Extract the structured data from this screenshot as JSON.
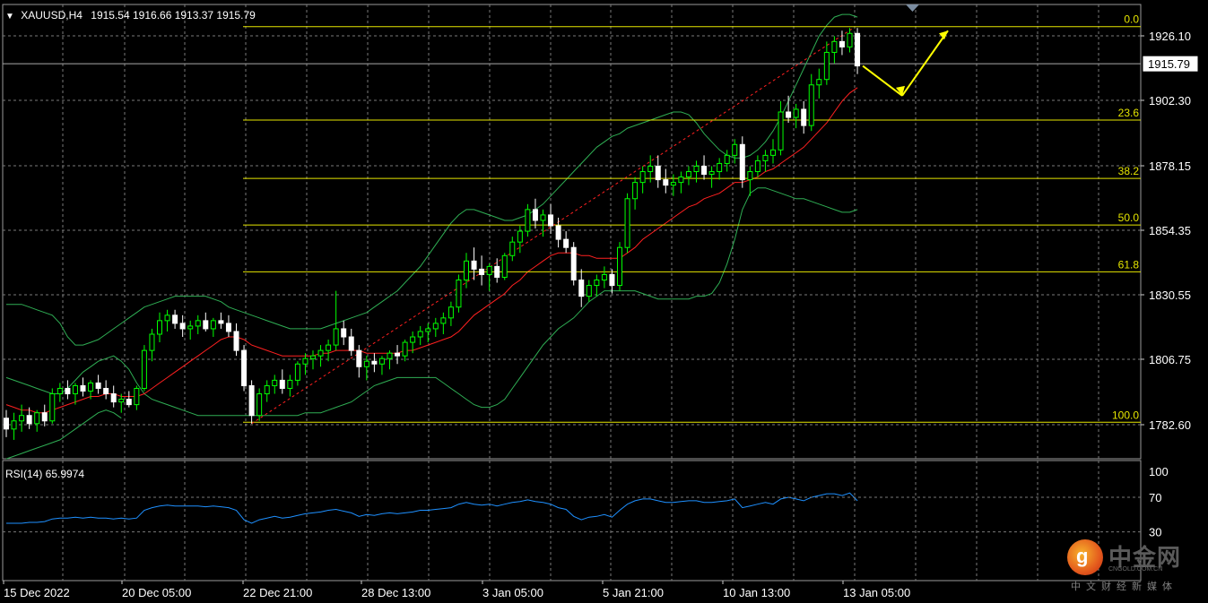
{
  "header": {
    "symbol": "XAUUSD,H4",
    "ohlc": "1915.54 1916.66 1913.37 1915.79"
  },
  "current_price": "1915.79",
  "rsi_label": "RSI(14) 65.9974",
  "watermark": {
    "brand": "中金网",
    "domain": "CNGOLD.COM.CN",
    "tagline": "中文财经新媒体",
    "logo_char": "g"
  },
  "colors": {
    "background": "#000000",
    "grid": "#7a7a7a",
    "bull": "#00ff00",
    "bear": "#ffffff",
    "ma": "#ff2020",
    "bollinger": "#2fae54",
    "fib": "#e6e600",
    "rsi": "#1e90ff",
    "trend": "#ff2020",
    "arrow": "#ffff00"
  },
  "chart_data": [
    {
      "type": "candlestick",
      "title": "XAUUSD,H4",
      "x_tick_labels": [
        "15 Dec 2022",
        "20 Dec 05:00",
        "22 Dec 21:00",
        "28 Dec 13:00",
        "3 Jan 05:00",
        "5 Jan 21:00",
        "10 Jan 13:00",
        "13 Jan 05:00"
      ],
      "y_tick_labels": [
        "1926.10",
        "1902.30",
        "1878.15",
        "1854.35",
        "1830.55",
        "1806.75",
        "1782.60"
      ],
      "ylim": [
        1769,
        1935
      ],
      "grid": true,
      "candles_ohlc": [
        [
          1785,
          1788,
          1778,
          1781
        ],
        [
          1781,
          1787,
          1777,
          1784
        ],
        [
          1784,
          1790,
          1780,
          1786
        ],
        [
          1786,
          1789,
          1781,
          1783
        ],
        [
          1783,
          1788,
          1780,
          1787
        ],
        [
          1787,
          1790,
          1782,
          1784
        ],
        [
          1784,
          1796,
          1783,
          1794
        ],
        [
          1794,
          1798,
          1791,
          1796
        ],
        [
          1796,
          1799,
          1792,
          1794
        ],
        [
          1794,
          1798,
          1790,
          1797
        ],
        [
          1797,
          1800,
          1793,
          1795
        ],
        [
          1795,
          1799,
          1792,
          1798
        ],
        [
          1798,
          1801,
          1794,
          1796
        ],
        [
          1796,
          1799,
          1792,
          1794
        ],
        [
          1794,
          1797,
          1789,
          1791
        ],
        [
          1791,
          1794,
          1787,
          1792
        ],
        [
          1792,
          1795,
          1789,
          1790
        ],
        [
          1790,
          1797,
          1788,
          1796
        ],
        [
          1796,
          1812,
          1795,
          1810
        ],
        [
          1810,
          1818,
          1806,
          1816
        ],
        [
          1816,
          1824,
          1813,
          1821
        ],
        [
          1821,
          1825,
          1817,
          1823
        ],
        [
          1823,
          1825,
          1818,
          1820
        ],
        [
          1820,
          1823,
          1815,
          1818
        ],
        [
          1818,
          1821,
          1814,
          1819
        ],
        [
          1819,
          1823,
          1816,
          1821
        ],
        [
          1821,
          1824,
          1817,
          1818
        ],
        [
          1818,
          1822,
          1815,
          1821
        ],
        [
          1821,
          1824,
          1818,
          1820
        ],
        [
          1820,
          1823,
          1815,
          1817
        ],
        [
          1817,
          1820,
          1808,
          1810
        ],
        [
          1810,
          1812,
          1795,
          1797
        ],
        [
          1797,
          1799,
          1783,
          1786
        ],
        [
          1786,
          1796,
          1784,
          1794
        ],
        [
          1794,
          1799,
          1791,
          1797
        ],
        [
          1797,
          1801,
          1794,
          1799
        ],
        [
          1799,
          1803,
          1794,
          1796
        ],
        [
          1796,
          1801,
          1793,
          1799
        ],
        [
          1799,
          1806,
          1797,
          1805
        ],
        [
          1805,
          1809,
          1801,
          1807
        ],
        [
          1807,
          1810,
          1803,
          1808
        ],
        [
          1808,
          1812,
          1804,
          1810
        ],
        [
          1810,
          1814,
          1806,
          1812
        ],
        [
          1812,
          1832,
          1810,
          1818
        ],
        [
          1818,
          1821,
          1812,
          1815
        ],
        [
          1815,
          1818,
          1808,
          1810
        ],
        [
          1810,
          1812,
          1800,
          1804
        ],
        [
          1804,
          1808,
          1799,
          1806
        ],
        [
          1806,
          1809,
          1802,
          1805
        ],
        [
          1805,
          1808,
          1801,
          1807
        ],
        [
          1807,
          1810,
          1803,
          1809
        ],
        [
          1809,
          1812,
          1805,
          1808
        ],
        [
          1808,
          1814,
          1806,
          1813
        ],
        [
          1813,
          1817,
          1809,
          1815
        ],
        [
          1815,
          1819,
          1812,
          1817
        ],
        [
          1817,
          1820,
          1813,
          1818
        ],
        [
          1818,
          1822,
          1815,
          1820
        ],
        [
          1820,
          1824,
          1816,
          1822
        ],
        [
          1822,
          1828,
          1819,
          1826
        ],
        [
          1826,
          1838,
          1824,
          1836
        ],
        [
          1836,
          1846,
          1833,
          1843
        ],
        [
          1843,
          1848,
          1836,
          1840
        ],
        [
          1840,
          1845,
          1834,
          1838
        ],
        [
          1838,
          1842,
          1832,
          1841
        ],
        [
          1841,
          1844,
          1835,
          1837
        ],
        [
          1837,
          1846,
          1836,
          1845
        ],
        [
          1845,
          1852,
          1843,
          1850
        ],
        [
          1850,
          1856,
          1846,
          1854
        ],
        [
          1854,
          1864,
          1852,
          1862
        ],
        [
          1862,
          1866,
          1855,
          1858
        ],
        [
          1858,
          1862,
          1852,
          1860
        ],
        [
          1860,
          1864,
          1853,
          1856
        ],
        [
          1856,
          1859,
          1848,
          1851
        ],
        [
          1851,
          1854,
          1846,
          1848
        ],
        [
          1848,
          1850,
          1834,
          1836
        ],
        [
          1836,
          1840,
          1826,
          1830
        ],
        [
          1830,
          1836,
          1828,
          1834
        ],
        [
          1834,
          1838,
          1830,
          1836
        ],
        [
          1836,
          1841,
          1833,
          1838
        ],
        [
          1838,
          1840,
          1831,
          1834
        ],
        [
          1834,
          1850,
          1832,
          1848
        ],
        [
          1848,
          1868,
          1846,
          1866
        ],
        [
          1866,
          1874,
          1862,
          1872
        ],
        [
          1872,
          1878,
          1868,
          1876
        ],
        [
          1876,
          1882,
          1872,
          1878
        ],
        [
          1878,
          1882,
          1870,
          1873
        ],
        [
          1873,
          1877,
          1868,
          1871
        ],
        [
          1871,
          1875,
          1867,
          1872
        ],
        [
          1872,
          1876,
          1868,
          1874
        ],
        [
          1874,
          1878,
          1871,
          1876
        ],
        [
          1876,
          1880,
          1872,
          1878
        ],
        [
          1878,
          1882,
          1873,
          1875
        ],
        [
          1875,
          1878,
          1870,
          1876
        ],
        [
          1876,
          1881,
          1873,
          1879
        ],
        [
          1879,
          1884,
          1876,
          1882
        ],
        [
          1882,
          1888,
          1879,
          1886
        ],
        [
          1886,
          1889,
          1870,
          1873
        ],
        [
          1873,
          1878,
          1867,
          1876
        ],
        [
          1876,
          1882,
          1874,
          1880
        ],
        [
          1880,
          1884,
          1876,
          1882
        ],
        [
          1882,
          1888,
          1879,
          1884
        ],
        [
          1884,
          1902,
          1882,
          1898
        ],
        [
          1898,
          1904,
          1894,
          1896
        ],
        [
          1896,
          1901,
          1892,
          1899
        ],
        [
          1899,
          1902,
          1890,
          1893
        ],
        [
          1893,
          1912,
          1891,
          1908
        ],
        [
          1908,
          1914,
          1903,
          1910
        ],
        [
          1910,
          1924,
          1908,
          1920
        ],
        [
          1920,
          1926,
          1916,
          1924
        ],
        [
          1924,
          1928,
          1919,
          1922
        ],
        [
          1922,
          1929,
          1920,
          1927
        ],
        [
          1927,
          1929,
          1912,
          1915
        ]
      ],
      "ma_values": [
        1790,
        1789,
        1788,
        1788,
        1787,
        1787,
        1788,
        1789,
        1790,
        1791,
        1792,
        1793,
        1793,
        1794,
        1794,
        1793,
        1793,
        1793,
        1794,
        1796,
        1798,
        1800,
        1802,
        1804,
        1806,
        1808,
        1810,
        1812,
        1814,
        1815,
        1815,
        1814,
        1812,
        1811,
        1810,
        1809,
        1808,
        1808,
        1808,
        1808,
        1808,
        1809,
        1809,
        1810,
        1810,
        1810,
        1810,
        1809,
        1809,
        1809,
        1809,
        1809,
        1810,
        1810,
        1811,
        1812,
        1813,
        1814,
        1815,
        1817,
        1820,
        1823,
        1825,
        1827,
        1829,
        1831,
        1834,
        1836,
        1839,
        1841,
        1843,
        1845,
        1846,
        1846,
        1846,
        1845,
        1845,
        1844,
        1844,
        1844,
        1844,
        1846,
        1848,
        1851,
        1853,
        1855,
        1857,
        1859,
        1861,
        1863,
        1864,
        1866,
        1867,
        1868,
        1870,
        1872,
        1872,
        1873,
        1874,
        1876,
        1877,
        1879,
        1881,
        1883,
        1885,
        1888,
        1891,
        1894,
        1898,
        1902,
        1905,
        1907
      ],
      "bollinger_upper": [
        1827,
        1827,
        1827,
        1826,
        1825,
        1824,
        1823,
        1820,
        1815,
        1812,
        1812,
        1813,
        1814,
        1816,
        1818,
        1820,
        1822,
        1824,
        1826,
        1827,
        1828,
        1829,
        1830,
        1830,
        1830,
        1830,
        1830,
        1829,
        1828,
        1826,
        1825,
        1824,
        1823,
        1822,
        1821,
        1820,
        1819,
        1818,
        1818,
        1818,
        1818,
        1818,
        1819,
        1820,
        1821,
        1822,
        1823,
        1824,
        1826,
        1828,
        1830,
        1832,
        1835,
        1838,
        1841,
        1845,
        1849,
        1853,
        1857,
        1860,
        1862,
        1862,
        1861,
        1860,
        1859,
        1858,
        1858,
        1859,
        1860,
        1862,
        1864,
        1867,
        1870,
        1873,
        1876,
        1879,
        1882,
        1885,
        1887,
        1889,
        1890,
        1892,
        1893,
        1894,
        1895,
        1896,
        1897,
        1898,
        1898,
        1897,
        1894,
        1890,
        1887,
        1884,
        1882,
        1881,
        1881,
        1882,
        1884,
        1887,
        1891,
        1896,
        1902,
        1908,
        1914,
        1920,
        1926,
        1930,
        1933,
        1934,
        1934,
        1933
      ],
      "bollinger_lower": [
        1800,
        1799,
        1798,
        1797,
        1796,
        1795,
        1794,
        1794,
        1796,
        1799,
        1802,
        1804,
        1806,
        1807,
        1808,
        1806,
        1803,
        1798,
        1794,
        1792,
        1791,
        1790,
        1789,
        1788,
        1787,
        1786,
        1786,
        1786,
        1786,
        1786,
        1786,
        1786,
        1786,
        1786,
        1786,
        1786,
        1786,
        1786,
        1786,
        1787,
        1787,
        1787,
        1788,
        1789,
        1790,
        1791,
        1793,
        1795,
        1797,
        1798,
        1799,
        1800,
        1800,
        1800,
        1800,
        1800,
        1800,
        1798,
        1796,
        1794,
        1792,
        1790,
        1789,
        1789,
        1790,
        1792,
        1796,
        1800,
        1804,
        1808,
        1812,
        1815,
        1818,
        1820,
        1822,
        1825,
        1828,
        1830,
        1832,
        1832,
        1832,
        1832,
        1832,
        1831,
        1830,
        1829,
        1829,
        1829,
        1829,
        1829,
        1830,
        1830,
        1831,
        1835,
        1842,
        1851,
        1862,
        1868,
        1870,
        1870,
        1869,
        1868,
        1867,
        1866,
        1866,
        1865,
        1864,
        1863,
        1862,
        1861,
        1861,
        1862
      ],
      "bollinger_lower_tail": [
        1770,
        1771,
        1772,
        1773,
        1774,
        1775,
        1776,
        1777,
        1779,
        1781,
        1783,
        1785,
        1787,
        1788,
        1787,
        1785
      ],
      "fibonacci": [
        {
          "level": "0.0",
          "price": 1929.5
        },
        {
          "level": "23.6",
          "price": 1895.0
        },
        {
          "level": "38.2",
          "price": 1873.5
        },
        {
          "level": "50.0",
          "price": 1856.3
        },
        {
          "level": "61.8",
          "price": 1839.0
        },
        {
          "level": "100.0",
          "price": 1783.5
        }
      ]
    },
    {
      "type": "line",
      "title": "RSI(14) 65.9974",
      "ylim": [
        0,
        100
      ],
      "y_tick_labels": [
        "100",
        "70",
        "30"
      ],
      "values": [
        40,
        40,
        40,
        41,
        41,
        42,
        45,
        46,
        46,
        47,
        46,
        47,
        46,
        46,
        45,
        46,
        45,
        46,
        55,
        58,
        60,
        61,
        60,
        60,
        60,
        60,
        59,
        60,
        59,
        58,
        55,
        44,
        40,
        44,
        46,
        48,
        46,
        47,
        49,
        51,
        52,
        53,
        55,
        56,
        54,
        52,
        48,
        50,
        49,
        51,
        52,
        51,
        52,
        53,
        55,
        55,
        56,
        57,
        58,
        62,
        64,
        62,
        61,
        62,
        60,
        62,
        64,
        65,
        67,
        65,
        64,
        62,
        58,
        56,
        48,
        44,
        47,
        48,
        50,
        47,
        55,
        62,
        66,
        68,
        68,
        66,
        64,
        64,
        65,
        66,
        66,
        64,
        64,
        65,
        66,
        68,
        58,
        60,
        62,
        64,
        62,
        68,
        70,
        68,
        66,
        70,
        72,
        74,
        74,
        72,
        75,
        66
      ]
    }
  ]
}
